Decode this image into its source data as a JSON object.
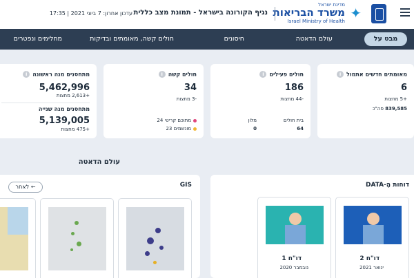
{
  "header": {
    "logo_small": "מדינת ישראל",
    "logo_main": "משרד הבריאות",
    "logo_en": "Israel Ministry of Health",
    "title": "נגיף הקורונה בישראל - תמונת מצב כללית",
    "last_update": "עדכון אחרון: 7 ביוני 2021 | 17:35"
  },
  "nav": {
    "tabs": [
      "מבט על",
      "עולם הדאטה",
      "חיסונים",
      "חולים קשה, מאומתים ובדיקות",
      "מחלימים ונפטרים"
    ]
  },
  "cards": {
    "new_cases": {
      "label": "מאומתים חדשים אתמול",
      "value": "6",
      "change": "+5",
      "change_unit": "מחצות",
      "total": "839,585",
      "total_label": "סה\"כ"
    },
    "active": {
      "label": "חולים פעילים",
      "value": "186",
      "change": "-44",
      "change_unit": "מחצות",
      "home_label": "בית חולים",
      "home_value": "64",
      "hotel_label": "מלון",
      "hotel_value": "0"
    },
    "severe": {
      "label": "חולים קשה",
      "value": "34",
      "change": "-3",
      "change_unit": "מחצות",
      "critical_label": "מתוכם קריטי",
      "critical_value": "24",
      "ventilated_label": "מונשמים",
      "ventilated_value": "23"
    },
    "vaccinated": {
      "label1": "מתחסנים מנה ראשונה",
      "value1": "5,462,996",
      "change1": "+2,613",
      "label2": "מתחסנים מנה שנייה",
      "value2": "5,139,005",
      "change2": "+475",
      "change_unit": "מחצות"
    }
  },
  "colors": {
    "critical_dot": "#e0457b",
    "ventilated_dot": "#f2b632",
    "accent": "#2d3e53"
  },
  "data_world": {
    "title": "עולם הדאטה",
    "reports": {
      "title": "דוחות הָ-DATA",
      "items": [
        {
          "title": "דו\"ח 2",
          "date": "ינואר 2021"
        },
        {
          "title": "דו\"ח 1",
          "date": "נובמבר 2020"
        }
      ]
    },
    "gis": {
      "title": "GIS",
      "back_label": "לאחר"
    }
  }
}
